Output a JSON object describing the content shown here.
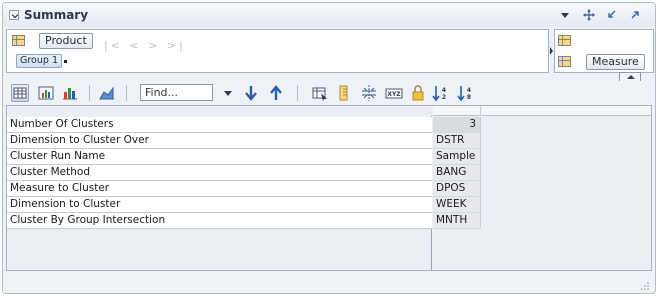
{
  "header": {
    "title": "Summary"
  },
  "layout": {
    "row_dimension": "Product",
    "group_label": "Group 1",
    "nav_arrows": "|< < > >|",
    "column_dimension": "Measure"
  },
  "toolbar": {
    "find_placeholder": "Find..."
  },
  "table": {
    "rows": [
      {
        "label": "Number Of Clusters",
        "value": "3"
      },
      {
        "label": "Dimension to Cluster Over",
        "value": "DSTR"
      },
      {
        "label": "Cluster Run Name",
        "value": "Sample"
      },
      {
        "label": "Cluster Method",
        "value": "BANG"
      },
      {
        "label": "Measure to Cluster",
        "value": "DPOS"
      },
      {
        "label": "Dimension to Cluster",
        "value": "WEEK"
      },
      {
        "label": "Cluster By Group Intersection",
        "value": "MNTH"
      }
    ]
  },
  "colors": {
    "accent": "#2a5ea8",
    "panel_bg": "#eef2f7",
    "border": "#a7b2bf"
  }
}
